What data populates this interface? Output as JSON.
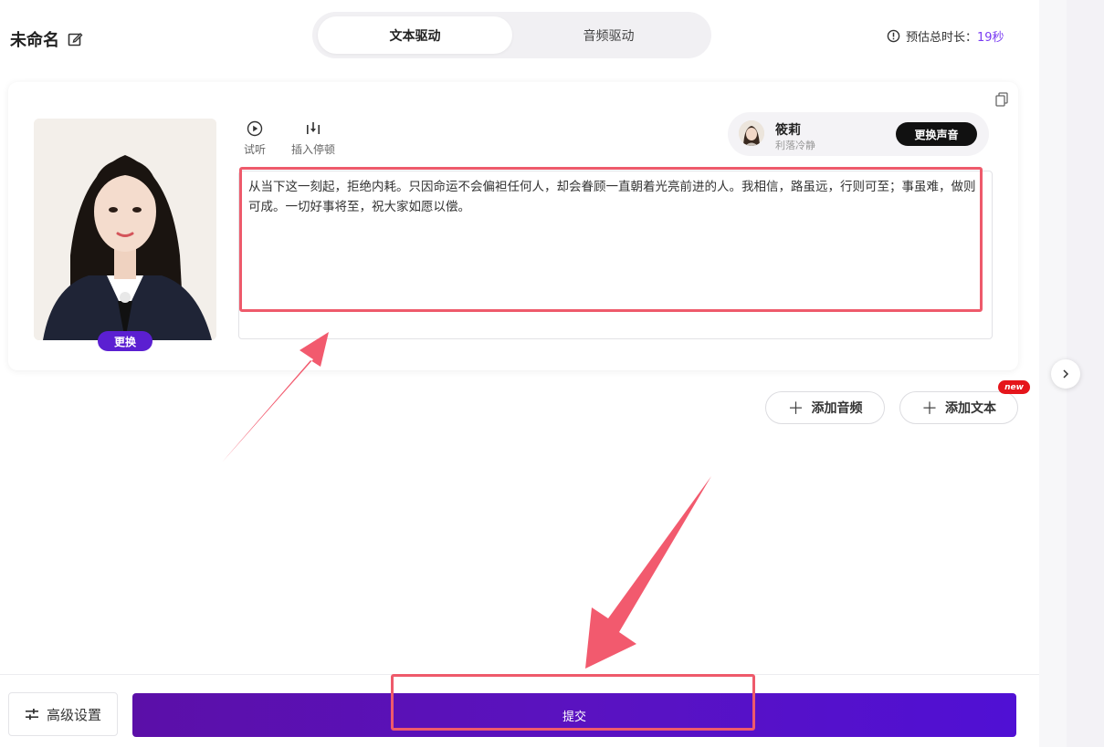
{
  "header": {
    "title": "未命名",
    "modes": [
      {
        "label": "文本驱动",
        "active": true
      },
      {
        "label": "音频驱动",
        "active": false
      }
    ],
    "duration_label": "预估总时长：",
    "duration_value": "19秒"
  },
  "editor": {
    "avatar_swap_label": "更换",
    "tools": [
      {
        "label": "试听",
        "icon": "play-icon"
      },
      {
        "label": "插入停顿",
        "icon": "pause-insert-icon"
      }
    ],
    "voice": {
      "name": "筱莉",
      "description": "利落冷静",
      "change_label": "更换声音"
    },
    "script_text": "从当下这一刻起，拒绝内耗。只因命运不会偏袒任何人，却会眷顾一直朝着光亮前进的人。我相信，路虽远，行则可至；事虽难，做则可成。一切好事将至，祝大家如愿以偿。"
  },
  "actions": {
    "add_audio_label": "添加音频",
    "add_text_label": "添加文本",
    "new_badge": "new"
  },
  "footer": {
    "advanced_label": "高级设置",
    "submit_label": "提交"
  },
  "colors": {
    "accent": "#5b1fd1",
    "duration_value": "#7a3cf2",
    "annotation": "#ee5a6b",
    "new_badge": "#e5151b"
  }
}
